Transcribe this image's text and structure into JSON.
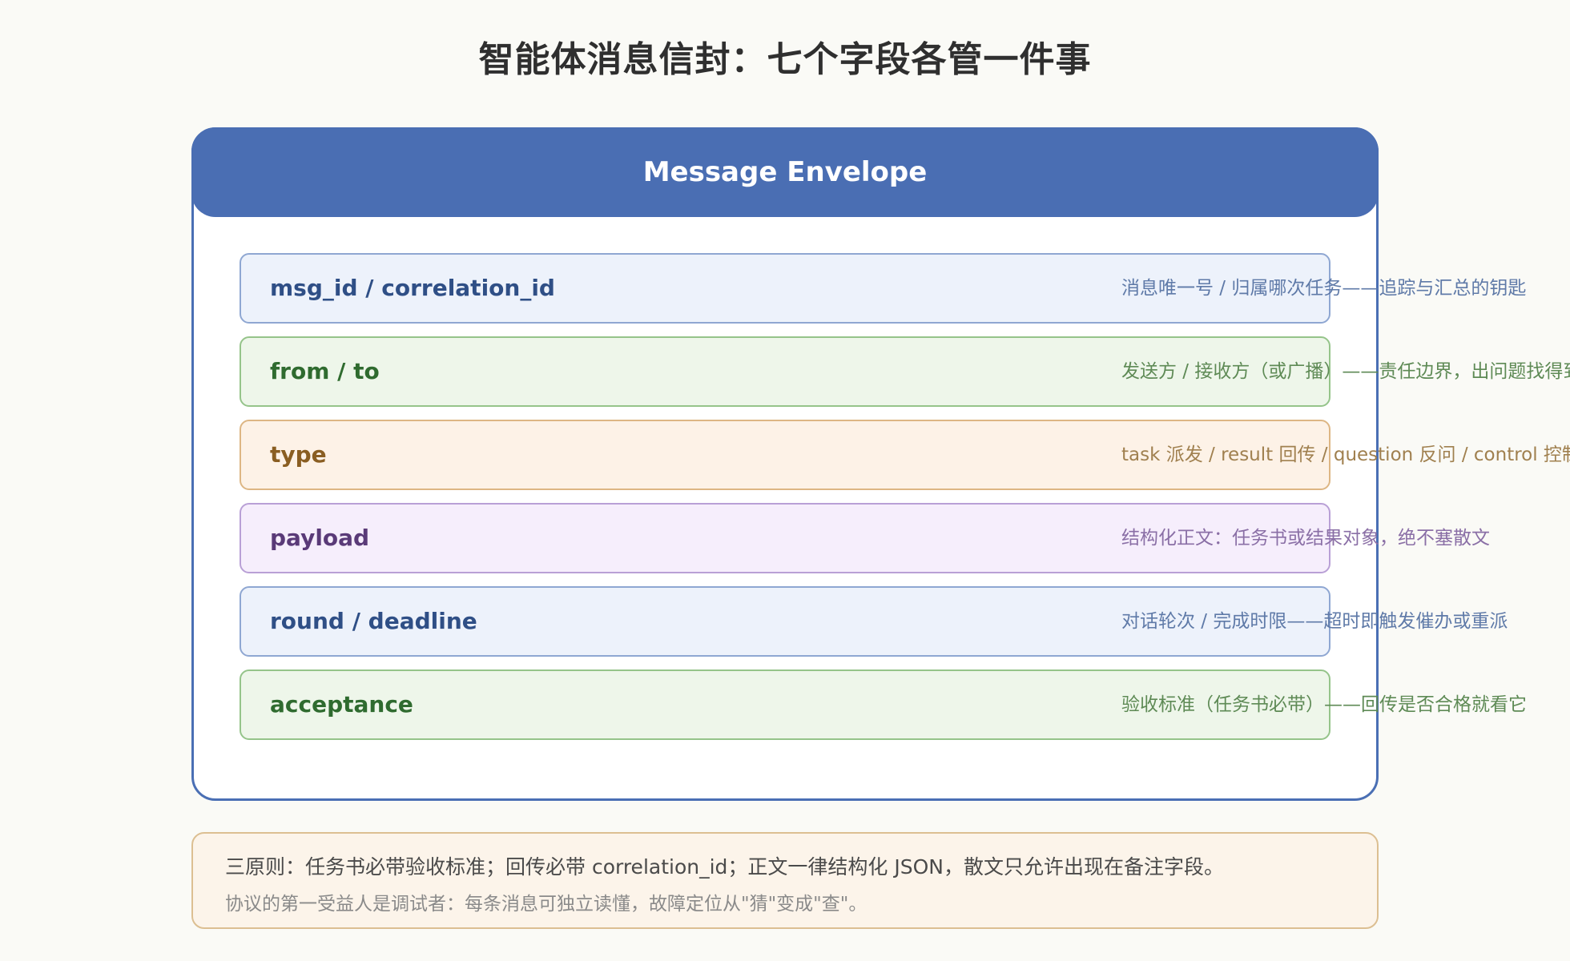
{
  "title": "智能体消息信封：七个字段各管一件事",
  "envelope": {
    "header": "Message Envelope",
    "fields": [
      {
        "name": "msg_id / correlation_id",
        "desc": "消息唯一号 / 归属哪次任务——追踪与汇总的钥匙",
        "accent": "#2f4f86",
        "bg": "#edf2fb",
        "border": "#8fa7d2",
        "desc_color": "#5f7aa8"
      },
      {
        "name": "from / to",
        "desc": "发送方 / 接收方（或广播）——责任边界，出问题找得到人",
        "accent": "#2f6b2f",
        "bg": "#eef6ea",
        "border": "#95c48a",
        "desc_color": "#5e8a55"
      },
      {
        "name": "type",
        "desc": "task 派发 / result 回传 / question 反问 / control 控制",
        "accent": "#8a5e22",
        "bg": "#fdf2e7",
        "border": "#ddb684",
        "desc_color": "#a0804f"
      },
      {
        "name": "payload",
        "desc": "结构化正文：任务书或结果对象，绝不塞散文",
        "accent": "#5a3a78",
        "bg": "#f6eefc",
        "border": "#b9a0d6",
        "desc_color": "#8a6fa6"
      },
      {
        "name": "round / deadline",
        "desc": "对话轮次 / 完成时限——超时即触发催办或重派",
        "accent": "#2f4f86",
        "bg": "#edf2fb",
        "border": "#8fa7d2",
        "desc_color": "#5f7aa8"
      },
      {
        "name": "acceptance",
        "desc": "验收标准（任务书必带）——回传是否合格就看它",
        "accent": "#2f6b2f",
        "bg": "#eef6ea",
        "border": "#95c48a",
        "desc_color": "#5e8a55"
      }
    ]
  },
  "principles": {
    "main": "三原则：任务书必带验收标准；回传必带 correlation_id；正文一律结构化 JSON，散文只允许出现在备注字段。",
    "sub": "协议的第一受益人是调试者：每条消息可独立读懂，故障定位从\"猜\"变成\"查\"。"
  }
}
